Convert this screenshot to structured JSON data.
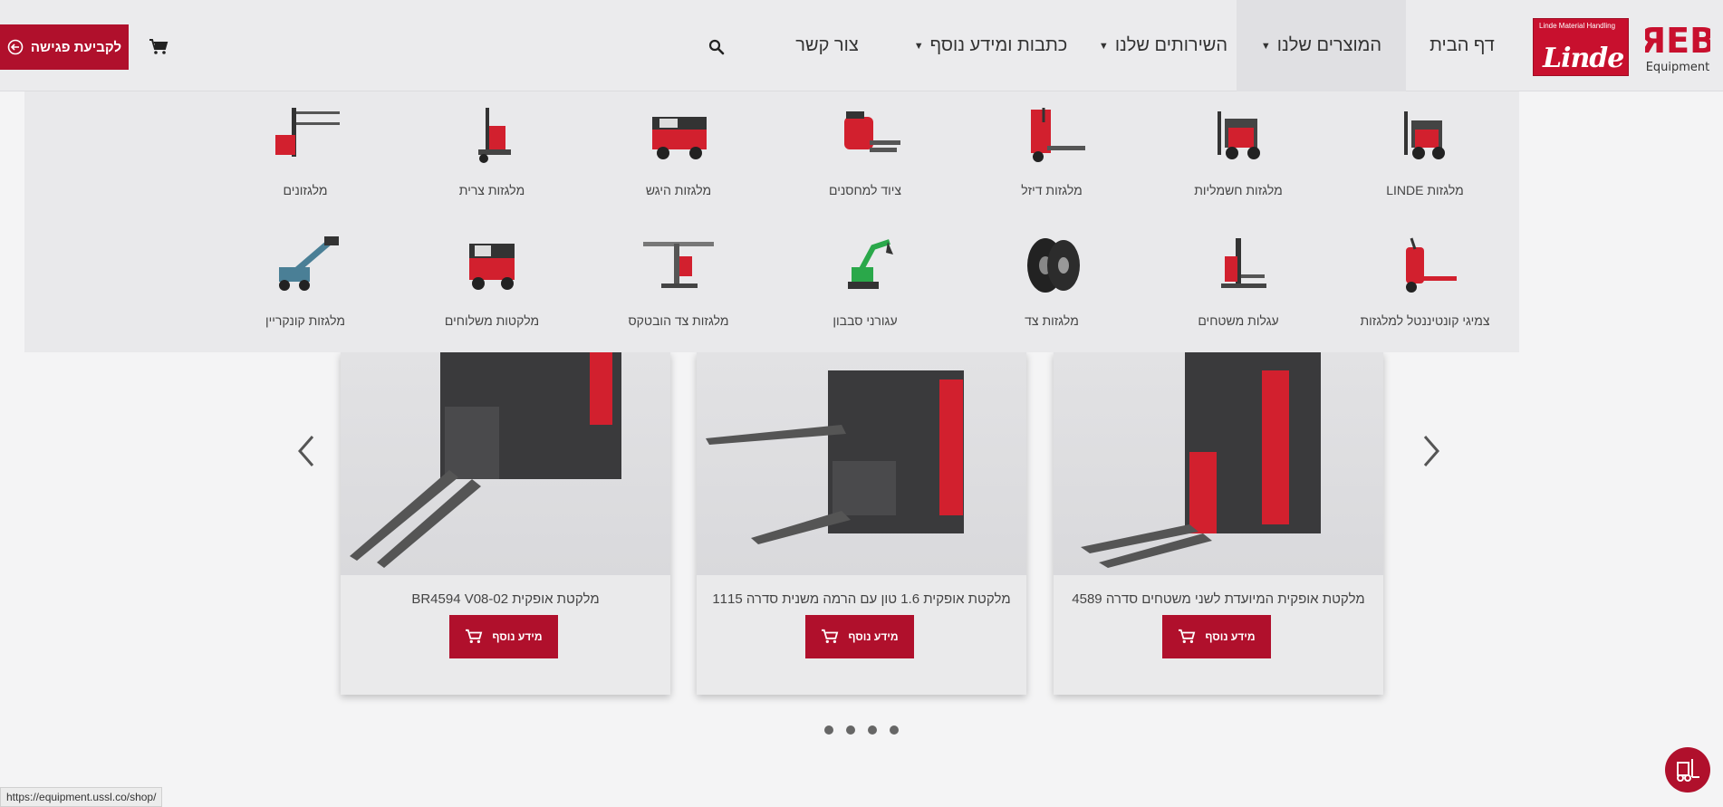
{
  "header": {
    "logo_linde_tag": "Linde Material Handling",
    "logo_linde_name": "Linde",
    "logo_reb_name": "Equipment",
    "nav": [
      {
        "label": "דף הבית",
        "dropdown": false
      },
      {
        "label": "המוצרים שלנו",
        "dropdown": true
      },
      {
        "label": "השירותים שלנו",
        "dropdown": true
      },
      {
        "label": "כתבות ומידע נוסף",
        "dropdown": true
      },
      {
        "label": "צור קשר",
        "dropdown": false
      }
    ],
    "appointment_label": "לקביעת פגישה"
  },
  "mega_menu": {
    "row1": [
      "מלגזות LINDE",
      "מלגזות חשמליות",
      "מלגזות דיזל",
      "ציוד למחסנים",
      "מלגזות היגש",
      "מלגזות צרית",
      "מלגזונים"
    ],
    "row2": [
      "צמיגי קונטיננטל למלגזות",
      "עגלות משטחים",
      "מלגזות צד",
      "עגורני סבבון",
      "מלגזות צד הובטקס",
      "מלקטות משלוחים",
      "מלגזות קונקריין"
    ]
  },
  "carousel": {
    "cards": [
      {
        "title": "מלקטת אופקית המיועדת לשני משטחים סדרה 4589",
        "button": "מידע נוסף"
      },
      {
        "title": "מלקטת אופקית 1.6 טון עם הרמה משנית סדרה 1115",
        "button": "מידע נוסף"
      },
      {
        "title": "מלקטת אופקית BR4594 V08-02",
        "button": "מידע נוסף"
      }
    ],
    "dot_count": 4
  },
  "status_bar": {
    "url": "https://equipment.ussl.co/shop/"
  },
  "colors": {
    "brand_red": "#b0102c",
    "linde_red": "#c8102e"
  }
}
